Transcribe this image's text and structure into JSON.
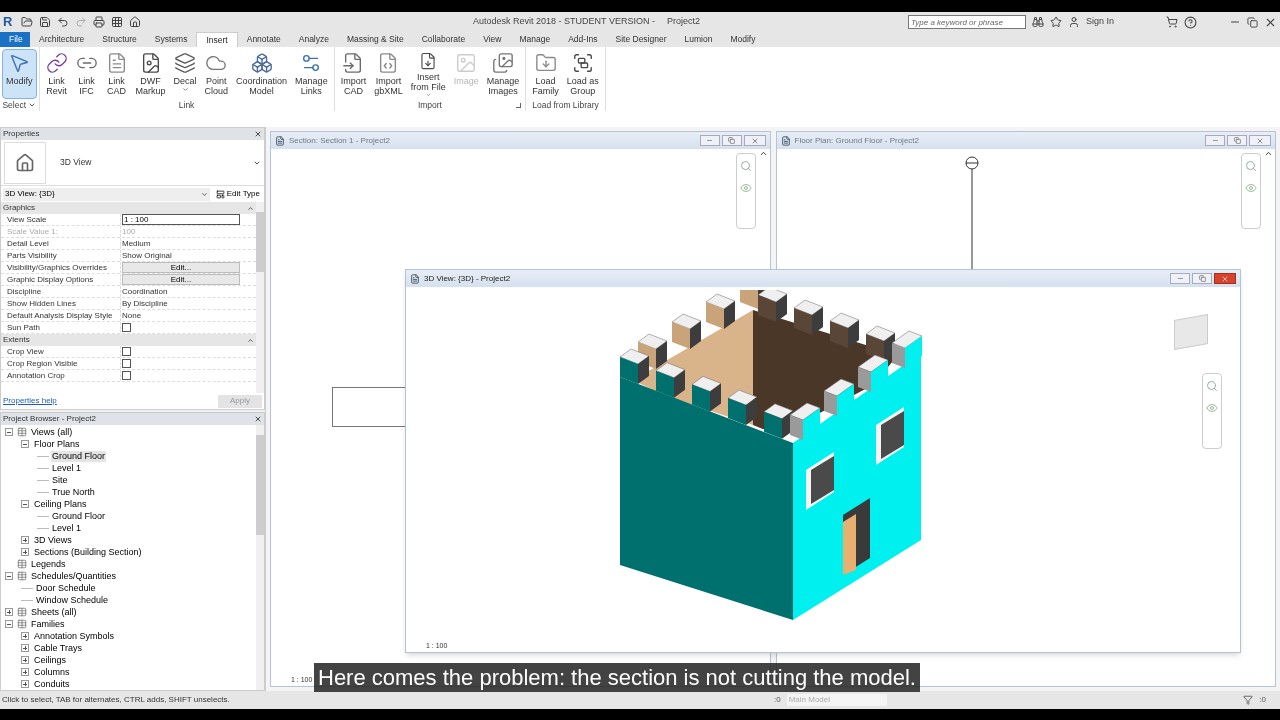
{
  "title_bar": {
    "logo": "R",
    "title": "Autodesk Revit 2018 - STUDENT VERSION -",
    "project": "Project2",
    "search_placeholder": "Type a keyword or phrase",
    "sign_in": "Sign In"
  },
  "ribbon_tabs": [
    {
      "label": "File",
      "kind": "file",
      "selected": false
    },
    {
      "label": "Architecture",
      "kind": "tab",
      "selected": false
    },
    {
      "label": "Structure",
      "kind": "tab",
      "selected": false
    },
    {
      "label": "Systems",
      "kind": "tab",
      "selected": false
    },
    {
      "label": "Insert",
      "kind": "tab",
      "selected": true
    },
    {
      "label": "Annotate",
      "kind": "tab",
      "selected": false
    },
    {
      "label": "Analyze",
      "kind": "tab",
      "selected": false
    },
    {
      "label": "Massing & Site",
      "kind": "tab",
      "selected": false
    },
    {
      "label": "Collaborate",
      "kind": "tab",
      "selected": false
    },
    {
      "label": "View",
      "kind": "tab",
      "selected": false
    },
    {
      "label": "Manage",
      "kind": "tab",
      "selected": false
    },
    {
      "label": "Add-Ins",
      "kind": "tab",
      "selected": false
    },
    {
      "label": "Site Designer",
      "kind": "tab",
      "selected": false
    },
    {
      "label": "Lumion",
      "kind": "tab",
      "selected": false
    },
    {
      "label": "Modify",
      "kind": "tab",
      "selected": false
    }
  ],
  "ribbon_panels": [
    {
      "label": "Select",
      "dropdown": true,
      "launcher": false,
      "buttons": [
        {
          "lines": [
            "Modify"
          ],
          "selected": true,
          "disabled": false,
          "dropdown": false
        }
      ]
    },
    {
      "label": "Link",
      "dropdown": false,
      "launcher": false,
      "buttons": [
        {
          "lines": [
            "Link",
            "Revit"
          ],
          "selected": false,
          "disabled": false,
          "dropdown": false
        },
        {
          "lines": [
            "Link",
            "IFC"
          ],
          "selected": false,
          "disabled": false,
          "dropdown": false
        },
        {
          "lines": [
            "Link",
            "CAD"
          ],
          "selected": false,
          "disabled": false,
          "dropdown": false
        },
        {
          "lines": [
            "DWF",
            "Markup"
          ],
          "selected": false,
          "disabled": false,
          "dropdown": false
        },
        {
          "lines": [
            "Decal"
          ],
          "selected": false,
          "disabled": false,
          "dropdown": true
        },
        {
          "lines": [
            "Point",
            "Cloud"
          ],
          "selected": false,
          "disabled": false,
          "dropdown": false
        },
        {
          "lines": [
            "Coordination",
            "Model"
          ],
          "selected": false,
          "disabled": false,
          "dropdown": false
        },
        {
          "lines": [
            "Manage",
            "Links"
          ],
          "selected": false,
          "disabled": false,
          "dropdown": false
        }
      ]
    },
    {
      "label": "Import",
      "dropdown": false,
      "launcher": true,
      "buttons": [
        {
          "lines": [
            "Import",
            "CAD"
          ],
          "selected": false,
          "disabled": false,
          "dropdown": false
        },
        {
          "lines": [
            "Import",
            "gbXML"
          ],
          "selected": false,
          "disabled": false,
          "dropdown": false
        },
        {
          "lines": [
            "Insert",
            "from File"
          ],
          "selected": false,
          "disabled": false,
          "dropdown": true
        },
        {
          "lines": [
            "Image"
          ],
          "selected": false,
          "disabled": true,
          "dropdown": false
        },
        {
          "lines": [
            "Manage",
            "Images"
          ],
          "selected": false,
          "disabled": false,
          "dropdown": false
        }
      ]
    },
    {
      "label": "Load from Library",
      "dropdown": false,
      "launcher": false,
      "buttons": [
        {
          "lines": [
            "Load",
            "Family"
          ],
          "selected": false,
          "disabled": false,
          "dropdown": false
        },
        {
          "lines": [
            "Load as",
            "Group"
          ],
          "selected": false,
          "disabled": false,
          "dropdown": false
        }
      ]
    }
  ],
  "properties": {
    "title": "Properties",
    "type_name": "3D View",
    "view_selector": "3D View: {3D}",
    "edit_type": "Edit Type",
    "sections": [
      {
        "name": "Graphics",
        "rows": [
          {
            "label": "View Scale",
            "value": "1 : 100",
            "kind": "field",
            "disabled": false
          },
          {
            "label": "Scale Value    1:",
            "value": "100",
            "kind": "text",
            "disabled": true
          },
          {
            "label": "Detail Level",
            "value": "Medium",
            "kind": "text",
            "disabled": false
          },
          {
            "label": "Parts Visibility",
            "value": "Show Original",
            "kind": "text",
            "disabled": false
          },
          {
            "label": "Visibility/Graphics Overrides",
            "value": "Edit...",
            "kind": "button",
            "disabled": false
          },
          {
            "label": "Graphic Display Options",
            "value": "Edit...",
            "kind": "button",
            "disabled": false
          },
          {
            "label": "Discipline",
            "value": "Coordination",
            "kind": "text",
            "disabled": false
          },
          {
            "label": "Show Hidden Lines",
            "value": "By Discipline",
            "kind": "text",
            "disabled": false
          },
          {
            "label": "Default Analysis Display Style",
            "value": "None",
            "kind": "text",
            "disabled": false
          },
          {
            "label": "Sun Path",
            "checked": false,
            "kind": "checkbox",
            "disabled": false
          }
        ]
      },
      {
        "name": "Extents",
        "rows": [
          {
            "label": "Crop View",
            "checked": false,
            "kind": "checkbox",
            "disabled": false
          },
          {
            "label": "Crop Region Visible",
            "checked": false,
            "kind": "checkbox",
            "disabled": false
          },
          {
            "label": "Annotation Crop",
            "checked": false,
            "kind": "checkbox",
            "disabled": false
          }
        ]
      }
    ],
    "help": "Properties help",
    "apply": "Apply"
  },
  "project_browser": {
    "title": "Project Browser - Project2",
    "tree": [
      {
        "label": "Views (all)",
        "kind": "group",
        "expanded": true,
        "selected": false,
        "children": [
          {
            "label": "Floor Plans",
            "kind": "group",
            "expanded": true,
            "selected": false,
            "children": [
              {
                "label": "Ground Floor",
                "kind": "leaf",
                "selected": true
              },
              {
                "label": "Level 1",
                "kind": "leaf",
                "selected": false
              },
              {
                "label": "Site",
                "kind": "leaf",
                "selected": false
              },
              {
                "label": "True North",
                "kind": "leaf",
                "selected": false
              }
            ]
          },
          {
            "label": "Ceiling Plans",
            "kind": "group",
            "expanded": true,
            "selected": false,
            "children": [
              {
                "label": "Ground Floor",
                "kind": "leaf",
                "selected": false
              },
              {
                "label": "Level 1",
                "kind": "leaf",
                "selected": false
              }
            ]
          },
          {
            "label": "3D Views",
            "kind": "group",
            "expanded": false,
            "selected": false
          },
          {
            "label": "Sections (Building Section)",
            "kind": "group",
            "expanded": false,
            "selected": false
          }
        ]
      },
      {
        "label": "Legends",
        "kind": "leaf",
        "selected": false
      },
      {
        "label": "Schedules/Quantities",
        "kind": "group",
        "expanded": true,
        "selected": false,
        "children": [
          {
            "label": "Door Schedule",
            "kind": "leaf",
            "selected": false
          },
          {
            "label": "Window Schedule",
            "kind": "leaf",
            "selected": false
          }
        ]
      },
      {
        "label": "Sheets (all)",
        "kind": "group",
        "expanded": false,
        "selected": false
      },
      {
        "label": "Families",
        "kind": "group",
        "expanded": true,
        "selected": false,
        "children": [
          {
            "label": "Annotation Symbols",
            "kind": "group",
            "expanded": false,
            "selected": false
          },
          {
            "label": "Cable Trays",
            "kind": "group",
            "expanded": false,
            "selected": false
          },
          {
            "label": "Ceilings",
            "kind": "group",
            "expanded": false,
            "selected": false
          },
          {
            "label": "Columns",
            "kind": "group",
            "expanded": false,
            "selected": false
          },
          {
            "label": "Conduits",
            "kind": "group",
            "expanded": false,
            "selected": false
          }
        ]
      }
    ]
  },
  "windows": [
    {
      "title": "Section: Section 1 - Project2",
      "active": false,
      "scale": "1 : 100"
    },
    {
      "title": "Floor Plan: Ground Floor - Project2",
      "active": false
    },
    {
      "title": "3D View: {3D} - Project2",
      "active": true,
      "scale": "1 : 100"
    }
  ],
  "subtitle": "Here comes the problem: the section is not cutting the model.",
  "status_bar": {
    "hint": "Click to select, TAB for alternates, CTRL adds, SHIFT unselects.",
    "workset_count": ":0",
    "model": "Main Model",
    "filter_count": ":0"
  }
}
